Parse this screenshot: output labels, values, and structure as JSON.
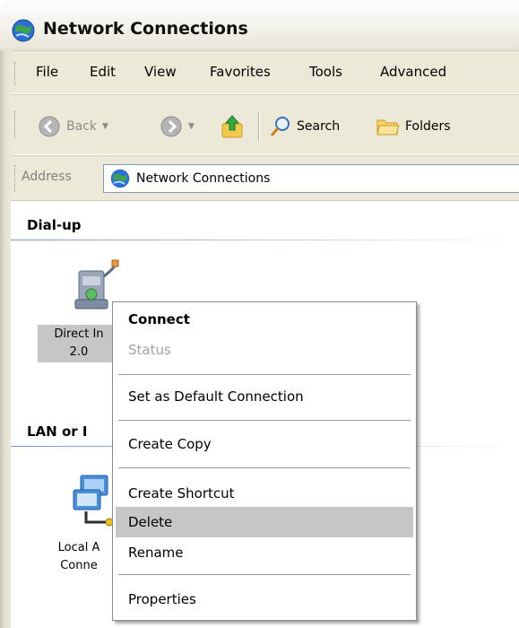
{
  "window": {
    "title": "Network Connections",
    "icon": "network-connections-icon"
  },
  "menubar": {
    "items": [
      "File",
      "Edit",
      "View",
      "Favorites",
      "Tools",
      "Advanced"
    ]
  },
  "toolbar": {
    "back_label": "Back",
    "forward_icon": "forward-arrow-icon",
    "up_icon": "up-folder-icon",
    "search_label": "Search",
    "folders_label": "Folders"
  },
  "address": {
    "label": "Address",
    "value": "Network Connections"
  },
  "groups": {
    "dialup": {
      "header": "Dial-up",
      "item_label_line1": "Direct In",
      "item_label_line2": "2.0"
    },
    "lan": {
      "header": "LAN or I",
      "item_label_line1": "Local A",
      "item_label_line2": "Conne"
    }
  },
  "context_menu": {
    "items": [
      {
        "label": "Connect",
        "style": "bold"
      },
      {
        "label": "Status",
        "style": "disabled"
      },
      {
        "label": "Set as Default Connection",
        "style": "normal"
      },
      {
        "label": "Create Copy",
        "style": "normal"
      },
      {
        "label": "Create Shortcut",
        "style": "normal"
      },
      {
        "label": "Delete",
        "style": "highlighted"
      },
      {
        "label": "Rename",
        "style": "normal"
      },
      {
        "label": "Properties",
        "style": "normal"
      }
    ]
  },
  "colors": {
    "highlight": "#c6c6c6",
    "toolbar_bg": "#ece9d8",
    "address_border": "#7f9db9",
    "group_rule": "#7a98c9"
  }
}
